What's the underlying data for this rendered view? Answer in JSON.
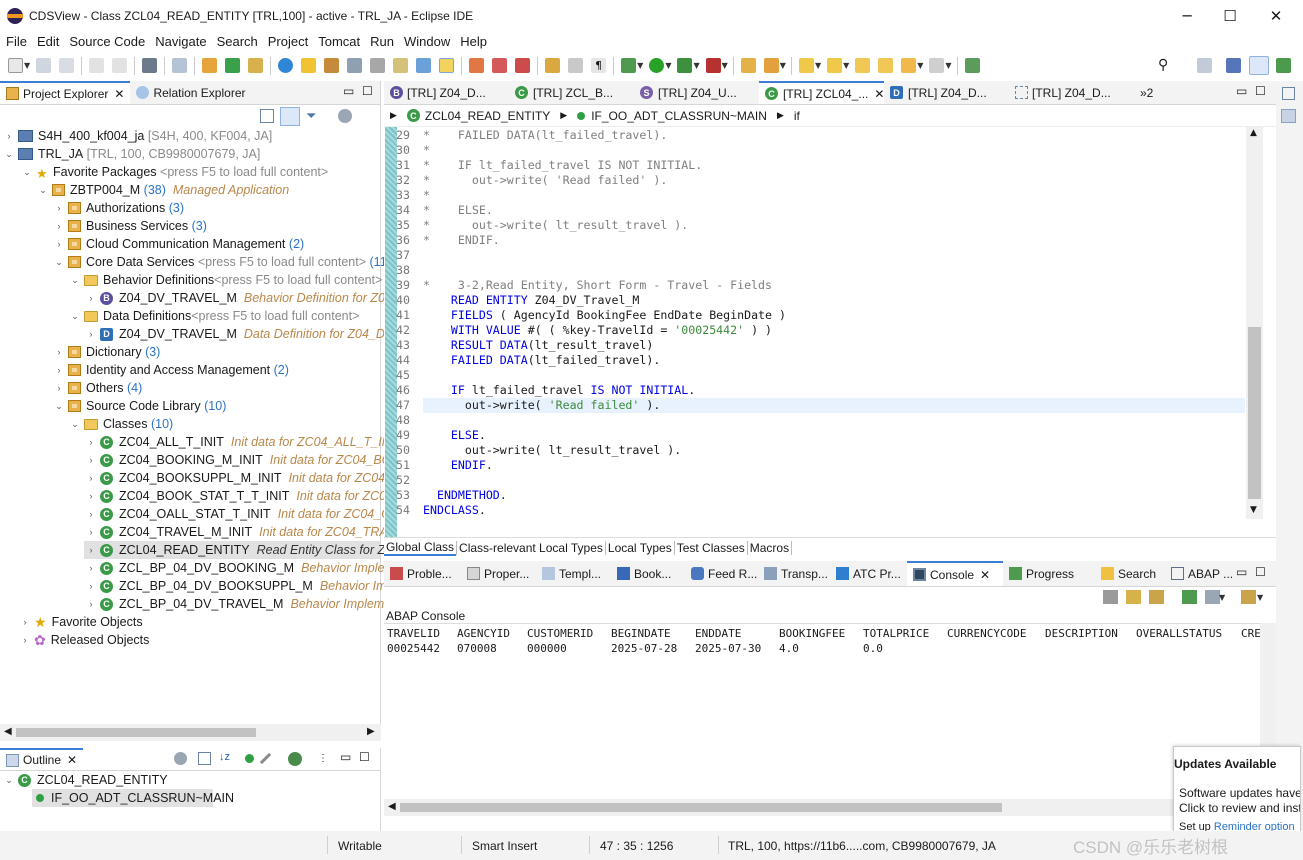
{
  "window": {
    "title": "CDSView - Class ZCL04_READ_ENTITY [TRL,100] - active - TRL_JA - Eclipse IDE",
    "minimize": "─",
    "maximize": "☐",
    "close": "✕"
  },
  "menu": [
    "File",
    "Edit",
    "Source Code",
    "Navigate",
    "Search",
    "Project",
    "Tomcat",
    "Run",
    "Window",
    "Help"
  ],
  "left_panel": {
    "tabs": [
      {
        "label": "Project Explorer",
        "close": "✕"
      },
      {
        "label": "Relation Explorer"
      }
    ],
    "tree": [
      {
        "text": "S4H_400_kf004_ja",
        "extra": "[S4H, 400, KF004, JA]",
        "twisty": "›"
      },
      {
        "text": "TRL_JA",
        "extra": "[TRL, 100, CB9980007679, JA]",
        "twisty": "⌄"
      },
      {
        "text": "Favorite Packages",
        "extra": "<press F5 to load full content>",
        "twisty": "⌄"
      },
      {
        "text": "ZBTP004_M",
        "count": "(38)",
        "desc": "Managed Application",
        "twisty": "⌄"
      },
      {
        "text": "Authorizations",
        "count": "(3)",
        "twisty": "›"
      },
      {
        "text": "Business Services",
        "count": "(3)",
        "twisty": "›"
      },
      {
        "text": "Cloud Communication Management",
        "count": "(2)",
        "twisty": "›"
      },
      {
        "text": "Core Data Services",
        "extra": "<press F5 to load full content>",
        "count": "(11)",
        "twisty": "⌄"
      },
      {
        "text": "Behavior Definitions",
        "extra": "<press F5 to load full content>",
        "twisty": "⌄"
      },
      {
        "text": "Z04_DV_TRAVEL_M",
        "desc": "Behavior Definition for Z04_I",
        "twisty": "›"
      },
      {
        "text": "Data Definitions",
        "extra": "<press F5 to load full content>",
        "twisty": "⌄"
      },
      {
        "text": "Z04_DV_TRAVEL_M",
        "desc": "Data Definition for Z04_DV_T",
        "twisty": "›"
      },
      {
        "text": "Dictionary",
        "count": "(3)",
        "twisty": "›"
      },
      {
        "text": "Identity and Access Management",
        "count": "(2)",
        "twisty": "›"
      },
      {
        "text": "Others",
        "count": "(4)",
        "twisty": "›"
      },
      {
        "text": "Source Code Library",
        "count": "(10)",
        "twisty": "⌄"
      },
      {
        "text": "Classes",
        "count": "(10)",
        "twisty": "⌄"
      },
      {
        "text": "ZC04_ALL_T_INIT",
        "desc": "Init data for ZC04_ALL_T_INIT",
        "twisty": "›"
      },
      {
        "text": "ZC04_BOOKING_M_INIT",
        "desc": "Init data for ZC04_BOOKI",
        "twisty": "›"
      },
      {
        "text": "ZC04_BOOKSUPPL_M_INIT",
        "desc": "Init data for ZC04_BO",
        "twisty": "›"
      },
      {
        "text": "ZC04_BOOK_STAT_T_T_INIT",
        "desc": "Init data for ZC04_BC",
        "twisty": "›"
      },
      {
        "text": "ZC04_OALL_STAT_T_INIT",
        "desc": "Init data for ZC04_OALL",
        "twisty": "›"
      },
      {
        "text": "ZC04_TRAVEL_M_INIT",
        "desc": "Init data for ZC04_TRAVEL",
        "twisty": "›"
      },
      {
        "text": "ZCL04_READ_ENTITY",
        "desc": "Read Entity Class for ZCL04",
        "twisty": "›"
      },
      {
        "text": "ZCL_BP_04_DV_BOOKING_M",
        "desc": "Behavior Implemen",
        "twisty": "›"
      },
      {
        "text": "ZCL_BP_04_DV_BOOKSUPPL_M",
        "desc": "Behavior Implem",
        "twisty": "›"
      },
      {
        "text": "ZCL_BP_04_DV_TRAVEL_M",
        "desc": "Behavior Implementat",
        "twisty": "›"
      },
      {
        "text": "Favorite Objects",
        "twisty": "›"
      },
      {
        "text": "Released Objects",
        "twisty": "›"
      }
    ]
  },
  "outline": {
    "tab": "Outline",
    "close": "✕",
    "items": [
      "ZCL04_READ_ENTITY",
      "IF_OO_ADT_CLASSRUN~MAIN"
    ]
  },
  "editor": {
    "tabs": [
      {
        "label": "[TRL] Z04_D..."
      },
      {
        "label": "[TRL] ZCL_B..."
      },
      {
        "label": "[TRL] Z04_U..."
      },
      {
        "label": "[TRL] ZCL04_...",
        "close": "✕"
      },
      {
        "label": "[TRL] Z04_D..."
      },
      {
        "label": "[TRL] Z04_D..."
      },
      {
        "label": "»2"
      }
    ],
    "breadcrumb": [
      "ZCL04_READ_ENTITY",
      "IF_OO_ADT_CLASSRUN~MAIN",
      "if"
    ],
    "lines": [
      {
        "n": "29",
        "t": "*    FAILED DATA(lt_failed_travel)."
      },
      {
        "n": "30",
        "t": "*"
      },
      {
        "n": "31",
        "t": "*    IF lt_failed_travel IS NOT INITIAL."
      },
      {
        "n": "32",
        "t": "*      out->write( 'Read failed' )."
      },
      {
        "n": "33",
        "t": "*"
      },
      {
        "n": "34",
        "t": "*    ELSE."
      },
      {
        "n": "35",
        "t": "*      out->write( lt_result_travel )."
      },
      {
        "n": "36",
        "t": "*    ENDIF."
      },
      {
        "n": "37",
        "t": ""
      },
      {
        "n": "38",
        "t": ""
      },
      {
        "n": "39",
        "t": "*    3-2,Read Entity, Short Form - Travel - Fields"
      },
      {
        "n": "40",
        "t": "    READ ENTITY Z04_DV_Travel_M"
      },
      {
        "n": "41",
        "t": "    FIELDS ( AgencyId BookingFee EndDate BeginDate )"
      },
      {
        "n": "42",
        "t": "    WITH VALUE #( ( %key-TravelId = '00025442' ) )"
      },
      {
        "n": "43",
        "t": "    RESULT DATA(lt_result_travel)"
      },
      {
        "n": "44",
        "t": "    FAILED DATA(lt_failed_travel)."
      },
      {
        "n": "45",
        "t": ""
      },
      {
        "n": "46",
        "t": "    IF lt_failed_travel IS NOT INITIAL."
      },
      {
        "n": "47",
        "t": "      out->write( 'Read failed' )."
      },
      {
        "n": "48",
        "t": ""
      },
      {
        "n": "49",
        "t": "    ELSE."
      },
      {
        "n": "50",
        "t": "      out->write( lt_result_travel )."
      },
      {
        "n": "51",
        "t": "    ENDIF."
      },
      {
        "n": "52",
        "t": ""
      },
      {
        "n": "53",
        "t": "  ENDMETHOD."
      },
      {
        "n": "54",
        "t": "ENDCLASS."
      }
    ],
    "bottom_tabs": [
      "Global Class",
      "Class-relevant Local Types",
      "Local Types",
      "Test Classes",
      "Macros"
    ]
  },
  "console": {
    "tabs": [
      {
        "label": "Proble..."
      },
      {
        "label": "Proper..."
      },
      {
        "label": "Templ..."
      },
      {
        "label": "Book..."
      },
      {
        "label": "Feed R..."
      },
      {
        "label": "Transp..."
      },
      {
        "label": "ATC Pr..."
      },
      {
        "label": "Console",
        "close": "✕"
      },
      {
        "label": "Progress"
      },
      {
        "label": "Search"
      },
      {
        "label": "ABAP ..."
      }
    ],
    "title": "ABAP Console",
    "headers": [
      "TRAVELID",
      "AGENCYID",
      "CUSTOMERID",
      "BEGINDATE",
      "ENDDATE",
      "BOOKINGFEE",
      "TOTALPRICE",
      "CURRENCYCODE",
      "DESCRIPTION",
      "OVERALLSTATUS",
      "CRE"
    ],
    "row": [
      "00025442",
      "070008",
      "000000",
      "2025-07-28",
      "2025-07-30",
      "4.0",
      "0.0",
      "",
      "",
      "",
      ""
    ]
  },
  "notification": {
    "title": "Updates Available",
    "line1": "Software updates have",
    "line2": "Click to review and inst",
    "line3a": "Set up",
    "line3b": "Reminder option"
  },
  "status": {
    "writable": "Writable",
    "insert": "Smart Insert",
    "position": "47 : 35 : 1256",
    "system": "TRL, 100, https://11b6.....com, CB9980007679, JA",
    "watermark": "CSDN @乐乐老树根"
  },
  "colors": {
    "accent": "#3b7ed8",
    "keyword": "#0000e6",
    "comment": "#7f7f7f",
    "string": "#3b8a3b",
    "selection": "#e1e1e1"
  }
}
